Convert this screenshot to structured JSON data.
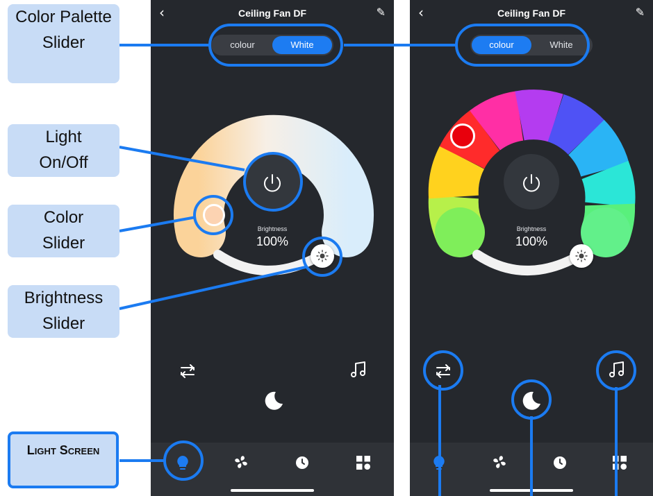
{
  "screens": [
    {
      "title": "Ceiling Fan DF",
      "tabs": [
        {
          "label": "colour",
          "active": false
        },
        {
          "label": "White",
          "active": true
        }
      ],
      "brightness_label": "Brightness",
      "brightness_value": "100%",
      "mode": "white"
    },
    {
      "title": "Ceiling Fan DF",
      "tabs": [
        {
          "label": "colour",
          "active": true
        },
        {
          "label": "White",
          "active": false
        }
      ],
      "brightness_label": "Brightness",
      "brightness_value": "100%",
      "mode": "colour"
    }
  ],
  "annotations": {
    "color_palette_slider": "Color Palette Slider",
    "light_on_off": "Light On/Off",
    "color_slider": "Color Slider",
    "brightness_slider": "Brightness Slider",
    "light_screen": "Light Screen"
  },
  "icons": {
    "back": "back-chevron-icon",
    "edit": "edit-pencil-icon",
    "power": "power-icon",
    "sun": "sun-icon",
    "scene": "loop-icon",
    "music": "music-note-icon",
    "sleep": "moon-icon",
    "nav": [
      "bulb-icon",
      "fan-icon",
      "clock-icon",
      "grid-icon"
    ]
  },
  "colors": {
    "accent": "#1d7cf2",
    "annotation_blue": "#1b7bf1",
    "label_bg": "#c8dcf6",
    "app_bg": "#25282d"
  }
}
